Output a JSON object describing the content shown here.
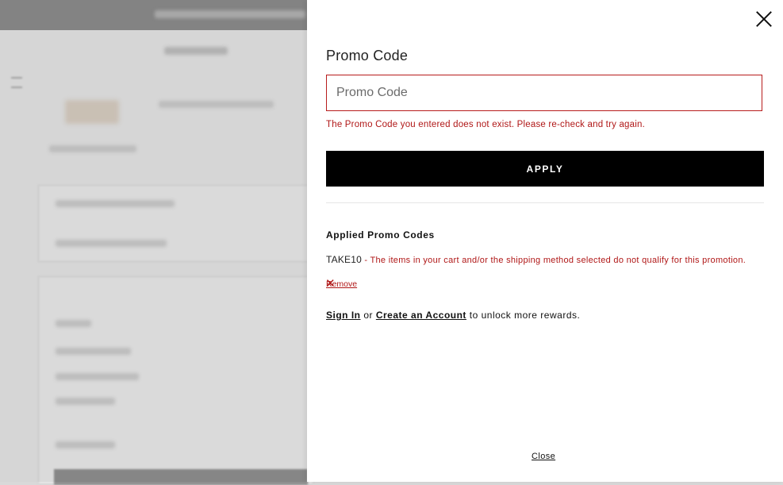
{
  "drawer": {
    "title": "Promo Code",
    "input": {
      "placeholder": "Promo Code",
      "value": ""
    },
    "error_message": "The Promo Code you entered does not exist. Please re-check and try again.",
    "apply_label": "APPLY",
    "applied_heading": "Applied Promo Codes",
    "applied_codes": [
      {
        "code": "TAKE10",
        "separator": " - ",
        "message": "The items in your cart and/or the shipping method selected do not qualify for this promotion.",
        "remove_label": "Remove"
      }
    ],
    "account": {
      "sign_in": "Sign In",
      "or": " or ",
      "create_account": "Create an Account",
      "suffix": " to unlock more rewards."
    },
    "close_label": "Close"
  },
  "colors": {
    "error": "#b01717",
    "apply_bg": "#000000",
    "input_border": "#b71c1c"
  }
}
